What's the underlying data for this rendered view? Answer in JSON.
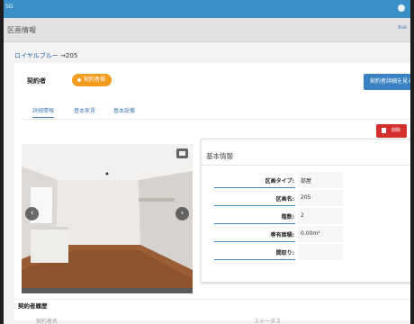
{
  "topbar": {
    "brand": "SG"
  },
  "subbar": {
    "title": "区画情報",
    "tiny": "Bub"
  },
  "breadcrumb": {
    "property": "ロイヤルブルー",
    "arrow": "→",
    "unit": "205"
  },
  "contract": {
    "label": "契約者",
    "badge": "契約者様",
    "detail_button": "契約者詳細を見る"
  },
  "tabs": [
    {
      "label": "詳細情報",
      "active": true
    },
    {
      "label": "基本家賃",
      "active": false
    },
    {
      "label": "基本設備",
      "active": false
    }
  ],
  "delete_button": "削除",
  "basic_info": {
    "title": "基本情報",
    "rows": [
      {
        "key": "区画タイプ:",
        "value": "部屋"
      },
      {
        "key": "区画名:",
        "value": "205"
      },
      {
        "key": "階数:",
        "value": "2"
      },
      {
        "key": "専有面積:",
        "value": "0.00m²"
      },
      {
        "key": "間取り:",
        "value": ""
      }
    ]
  },
  "history": {
    "title": "契約者履歴",
    "col1": "契約者名",
    "col2": "ステータス"
  },
  "icons": {
    "prev": "chevron-left-icon",
    "next": "chevron-right-icon",
    "gallery": "camera-icon",
    "delete": "trash-icon"
  },
  "colors": {
    "topbar": "#3b8fc7",
    "badge": "#f39c1f",
    "detail_button": "#3b82c4",
    "delete_button": "#d32f2f"
  }
}
